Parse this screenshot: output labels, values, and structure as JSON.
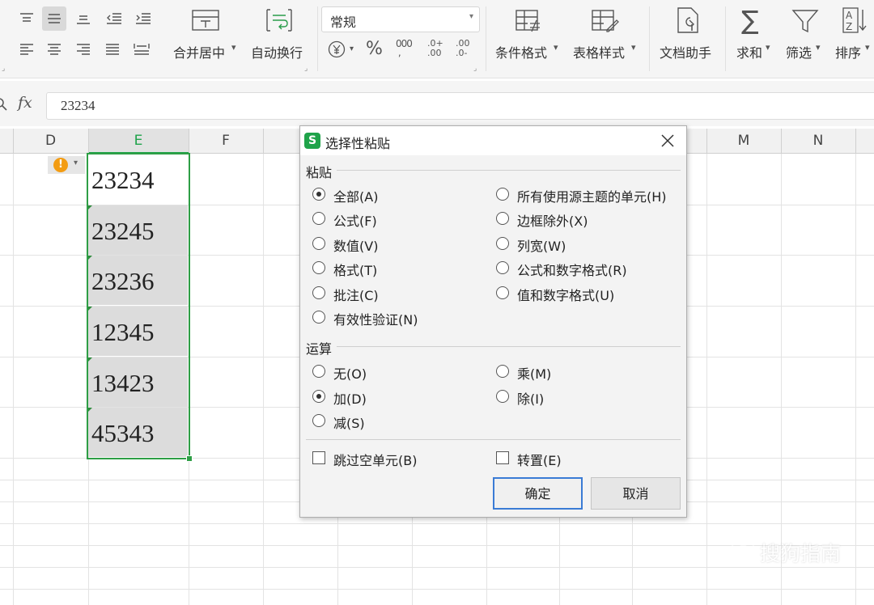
{
  "ribbon": {
    "merge_center": "合并居中",
    "auto_wrap": "自动换行",
    "number_format": "常规",
    "conditional_format": "条件格式",
    "table_style": "表格样式",
    "doc_assistant": "文档助手",
    "sum": "求和",
    "filter": "筛选",
    "sort": "排序"
  },
  "formula_bar": {
    "fx": "fx",
    "value": "23234"
  },
  "columns": [
    "D",
    "E",
    "F",
    "M",
    "N"
  ],
  "cells": [
    "23234",
    "23245",
    "23236",
    "12345",
    "13423",
    "45343"
  ],
  "dialog": {
    "title": "选择性粘贴",
    "paste_section": "粘贴",
    "paste_options": [
      {
        "label": "全部(A)",
        "checked": true
      },
      {
        "label": "公式(F)",
        "checked": false
      },
      {
        "label": "数值(V)",
        "checked": false
      },
      {
        "label": "格式(T)",
        "checked": false
      },
      {
        "label": "批注(C)",
        "checked": false
      },
      {
        "label": "有效性验证(N)",
        "checked": false
      },
      {
        "label": "所有使用源主题的单元(H)",
        "checked": false
      },
      {
        "label": "边框除外(X)",
        "checked": false
      },
      {
        "label": "列宽(W)",
        "checked": false
      },
      {
        "label": "公式和数字格式(R)",
        "checked": false
      },
      {
        "label": "值和数字格式(U)",
        "checked": false
      }
    ],
    "op_section": "运算",
    "op_options": [
      {
        "label": "无(O)",
        "checked": false
      },
      {
        "label": "加(D)",
        "checked": true
      },
      {
        "label": "减(S)",
        "checked": false
      },
      {
        "label": "乘(M)",
        "checked": false
      },
      {
        "label": "除(I)",
        "checked": false
      }
    ],
    "skip_blanks": "跳过空单元(B)",
    "transpose": "转置(E)",
    "ok": "确定",
    "cancel": "取消"
  },
  "watermark": "搜狗指南",
  "colors": {
    "accent_green": "#1fa34a",
    "selection_border": "#2e9e45",
    "ok_border": "#3a7bd5"
  }
}
